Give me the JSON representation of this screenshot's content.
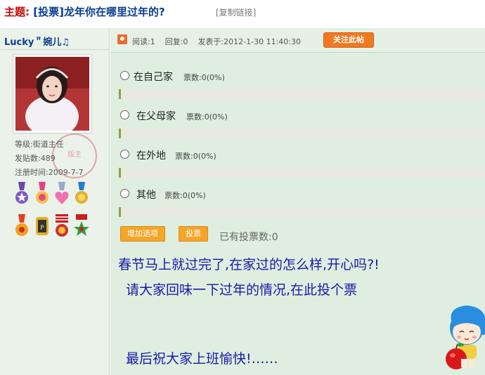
{
  "header": {
    "topic_label": "主题:",
    "title": "[投票]龙年你在哪里过年的?",
    "copy_link": "[复制链接]"
  },
  "sidebar": {
    "username": "Lucky＂婉儿♫",
    "avatar_icon": "avatar-portrait",
    "stamp_text": "版主",
    "level": "等级:街道主任",
    "posts": "发贴数:489",
    "registered": "注册时间:2009-7-7",
    "medals": [
      "medal-purple-icon",
      "medal-pink-icon",
      "medal-heart-icon",
      "medal-gold-icon",
      "medal-flower-icon",
      "medal-badge-icon",
      "medal-stripes-icon",
      "medal-star-icon"
    ]
  },
  "meta": {
    "reads": "阅读:1",
    "replies": "回复:0",
    "posted": "发表于:2012-1-30 11:40:30",
    "follow_label": "关注此帖"
  },
  "poll": {
    "options": [
      {
        "label": "在自己家",
        "votes": "票数:0(0%)",
        "percent": 0
      },
      {
        "label": "在父母家",
        "votes": "票数:0(0%)",
        "percent": 0
      },
      {
        "label": "在外地",
        "votes": "票数:0(0%)",
        "percent": 0
      },
      {
        "label": "其他",
        "votes": "票数:0(0%)",
        "percent": 0
      }
    ],
    "add_option_label": "增加选项",
    "vote_label": "投票",
    "total_votes": "已有投票数:0"
  },
  "post": {
    "line1": "春节马上就过完了,在家过的怎么样,开心吗?!",
    "line2": "请大家回味一下过年的情况,在此投个票",
    "line3": "最后祝大家上班愉快!……"
  },
  "colors": {
    "accent": "#f07820",
    "title_red": "#cc0000",
    "text_blue": "#1a1aa8"
  }
}
